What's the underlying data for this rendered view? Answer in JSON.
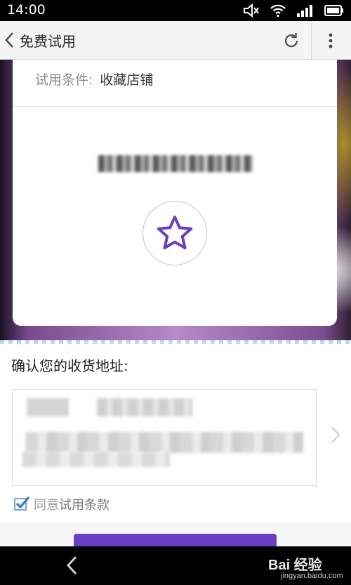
{
  "status_bar": {
    "time": "14:00",
    "icons": [
      "mute-icon",
      "wifi-icon",
      "signal-icon",
      "battery-icon"
    ]
  },
  "app_bar": {
    "title": "免费试用",
    "icons": [
      "back-arrow-icon",
      "refresh-icon",
      "more-vert-icon"
    ]
  },
  "card": {
    "condition_label": "试用条件:",
    "condition_value": "收藏店铺",
    "favorite_icon": "star-outline-icon"
  },
  "address": {
    "title": "确认您的收货地址:"
  },
  "agreement": {
    "checked": true,
    "text_prefix": "同意",
    "text_link": "试用条款"
  },
  "colors": {
    "accent_purple": "#6a3ec4",
    "star_purple": "#6b40b8",
    "checkbox_blue": "#2a7fc0"
  },
  "watermark": {
    "main": "Bai 经验",
    "sub": "jingyan.baidu.com"
  }
}
